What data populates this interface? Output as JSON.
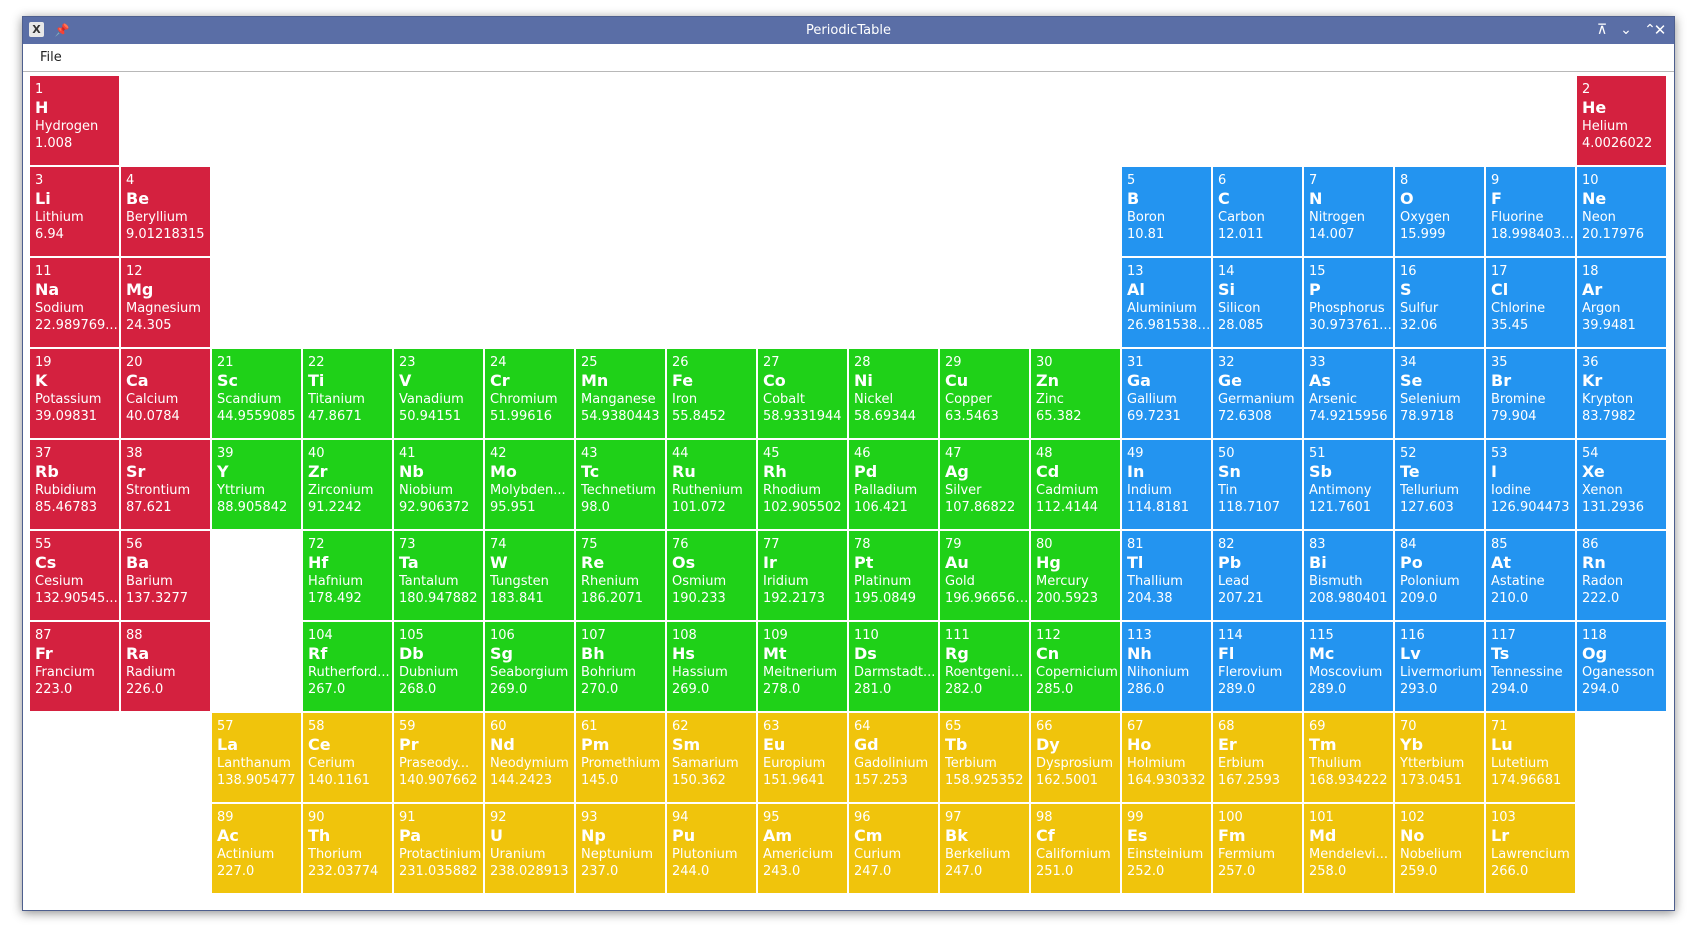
{
  "window": {
    "title": "PeriodicTable",
    "icons": {
      "app": "x-app-icon",
      "pin": "pin-icon",
      "minimize": "minimize-icon",
      "shade": "shade-icon",
      "maximize": "maximize-icon",
      "close": "close-icon"
    }
  },
  "menu": {
    "file_label": "File"
  },
  "colors": {
    "red": "#d4213f",
    "blue": "#2394f0",
    "green": "#1fd118",
    "yellow": "#f0c40c",
    "titlebar": "#5a6ea6"
  },
  "elements": [
    {
      "n": "1",
      "s": "H",
      "name": "Hydrogen",
      "w": "1.008",
      "c": "red",
      "r": 0,
      "col": 0
    },
    {
      "n": "2",
      "s": "He",
      "name": "Helium",
      "w": "4.0026022",
      "c": "red",
      "r": 0,
      "col": 17
    },
    {
      "n": "3",
      "s": "Li",
      "name": "Lithium",
      "w": "6.94",
      "c": "red",
      "r": 1,
      "col": 0
    },
    {
      "n": "4",
      "s": "Be",
      "name": "Beryllium",
      "w": "9.01218315",
      "c": "red",
      "r": 1,
      "col": 1
    },
    {
      "n": "5",
      "s": "B",
      "name": "Boron",
      "w": "10.81",
      "c": "blue",
      "r": 1,
      "col": 12
    },
    {
      "n": "6",
      "s": "C",
      "name": "Carbon",
      "w": "12.011",
      "c": "blue",
      "r": 1,
      "col": 13
    },
    {
      "n": "7",
      "s": "N",
      "name": "Nitrogen",
      "w": "14.007",
      "c": "blue",
      "r": 1,
      "col": 14
    },
    {
      "n": "8",
      "s": "O",
      "name": "Oxygen",
      "w": "15.999",
      "c": "blue",
      "r": 1,
      "col": 15
    },
    {
      "n": "9",
      "s": "F",
      "name": "Fluorine",
      "w": "18.998403...",
      "c": "blue",
      "r": 1,
      "col": 16
    },
    {
      "n": "10",
      "s": "Ne",
      "name": "Neon",
      "w": "20.17976",
      "c": "blue",
      "r": 1,
      "col": 17
    },
    {
      "n": "11",
      "s": "Na",
      "name": "Sodium",
      "w": "22.989769...",
      "c": "red",
      "r": 2,
      "col": 0
    },
    {
      "n": "12",
      "s": "Mg",
      "name": "Magnesium",
      "w": "24.305",
      "c": "red",
      "r": 2,
      "col": 1
    },
    {
      "n": "13",
      "s": "Al",
      "name": "Aluminium",
      "w": "26.98153857",
      "c": "blue",
      "r": 2,
      "col": 12
    },
    {
      "n": "14",
      "s": "Si",
      "name": "Silicon",
      "w": "28.085",
      "c": "blue",
      "r": 2,
      "col": 13
    },
    {
      "n": "15",
      "s": "P",
      "name": "Phosphorus",
      "w": "30.973761...",
      "c": "blue",
      "r": 2,
      "col": 14
    },
    {
      "n": "16",
      "s": "S",
      "name": "Sulfur",
      "w": "32.06",
      "c": "blue",
      "r": 2,
      "col": 15
    },
    {
      "n": "17",
      "s": "Cl",
      "name": "Chlorine",
      "w": "35.45",
      "c": "blue",
      "r": 2,
      "col": 16
    },
    {
      "n": "18",
      "s": "Ar",
      "name": "Argon",
      "w": "39.9481",
      "c": "blue",
      "r": 2,
      "col": 17
    },
    {
      "n": "19",
      "s": "K",
      "name": "Potassium",
      "w": "39.09831",
      "c": "red",
      "r": 3,
      "col": 0
    },
    {
      "n": "20",
      "s": "Ca",
      "name": "Calcium",
      "w": "40.0784",
      "c": "red",
      "r": 3,
      "col": 1
    },
    {
      "n": "21",
      "s": "Sc",
      "name": "Scandium",
      "w": "44.9559085",
      "c": "green",
      "r": 3,
      "col": 2
    },
    {
      "n": "22",
      "s": "Ti",
      "name": "Titanium",
      "w": "47.8671",
      "c": "green",
      "r": 3,
      "col": 3
    },
    {
      "n": "23",
      "s": "V",
      "name": "Vanadium",
      "w": "50.94151",
      "c": "green",
      "r": 3,
      "col": 4
    },
    {
      "n": "24",
      "s": "Cr",
      "name": "Chromium",
      "w": "51.99616",
      "c": "green",
      "r": 3,
      "col": 5
    },
    {
      "n": "25",
      "s": "Mn",
      "name": "Manganese",
      "w": "54.9380443",
      "c": "green",
      "r": 3,
      "col": 6
    },
    {
      "n": "26",
      "s": "Fe",
      "name": "Iron",
      "w": "55.8452",
      "c": "green",
      "r": 3,
      "col": 7
    },
    {
      "n": "27",
      "s": "Co",
      "name": "Cobalt",
      "w": "58.9331944",
      "c": "green",
      "r": 3,
      "col": 8
    },
    {
      "n": "28",
      "s": "Ni",
      "name": "Nickel",
      "w": "58.69344",
      "c": "green",
      "r": 3,
      "col": 9
    },
    {
      "n": "29",
      "s": "Cu",
      "name": "Copper",
      "w": "63.5463",
      "c": "green",
      "r": 3,
      "col": 10
    },
    {
      "n": "30",
      "s": "Zn",
      "name": "Zinc",
      "w": "65.382",
      "c": "green",
      "r": 3,
      "col": 11
    },
    {
      "n": "31",
      "s": "Ga",
      "name": "Gallium",
      "w": "69.7231",
      "c": "blue",
      "r": 3,
      "col": 12
    },
    {
      "n": "32",
      "s": "Ge",
      "name": "Germanium",
      "w": "72.6308",
      "c": "blue",
      "r": 3,
      "col": 13
    },
    {
      "n": "33",
      "s": "As",
      "name": "Arsenic",
      "w": "74.9215956",
      "c": "blue",
      "r": 3,
      "col": 14
    },
    {
      "n": "34",
      "s": "Se",
      "name": "Selenium",
      "w": "78.9718",
      "c": "blue",
      "r": 3,
      "col": 15
    },
    {
      "n": "35",
      "s": "Br",
      "name": "Bromine",
      "w": "79.904",
      "c": "blue",
      "r": 3,
      "col": 16
    },
    {
      "n": "36",
      "s": "Kr",
      "name": "Krypton",
      "w": "83.7982",
      "c": "blue",
      "r": 3,
      "col": 17
    },
    {
      "n": "37",
      "s": "Rb",
      "name": "Rubidium",
      "w": "85.46783",
      "c": "red",
      "r": 4,
      "col": 0
    },
    {
      "n": "38",
      "s": "Sr",
      "name": "Strontium",
      "w": "87.621",
      "c": "red",
      "r": 4,
      "col": 1
    },
    {
      "n": "39",
      "s": "Y",
      "name": "Yttrium",
      "w": "88.905842",
      "c": "green",
      "r": 4,
      "col": 2
    },
    {
      "n": "40",
      "s": "Zr",
      "name": "Zirconium",
      "w": "91.2242",
      "c": "green",
      "r": 4,
      "col": 3
    },
    {
      "n": "41",
      "s": "Nb",
      "name": "Niobium",
      "w": "92.906372",
      "c": "green",
      "r": 4,
      "col": 4
    },
    {
      "n": "42",
      "s": "Mo",
      "name": "Molybden...",
      "w": "95.951",
      "c": "green",
      "r": 4,
      "col": 5
    },
    {
      "n": "43",
      "s": "Tc",
      "name": "Technetium",
      "w": "98.0",
      "c": "green",
      "r": 4,
      "col": 6
    },
    {
      "n": "44",
      "s": "Ru",
      "name": "Ruthenium",
      "w": "101.072",
      "c": "green",
      "r": 4,
      "col": 7
    },
    {
      "n": "45",
      "s": "Rh",
      "name": "Rhodium",
      "w": "102.905502",
      "c": "green",
      "r": 4,
      "col": 8
    },
    {
      "n": "46",
      "s": "Pd",
      "name": "Palladium",
      "w": "106.421",
      "c": "green",
      "r": 4,
      "col": 9
    },
    {
      "n": "47",
      "s": "Ag",
      "name": "Silver",
      "w": "107.86822",
      "c": "green",
      "r": 4,
      "col": 10
    },
    {
      "n": "48",
      "s": "Cd",
      "name": "Cadmium",
      "w": "112.4144",
      "c": "green",
      "r": 4,
      "col": 11
    },
    {
      "n": "49",
      "s": "In",
      "name": "Indium",
      "w": "114.8181",
      "c": "blue",
      "r": 4,
      "col": 12
    },
    {
      "n": "50",
      "s": "Sn",
      "name": "Tin",
      "w": "118.7107",
      "c": "blue",
      "r": 4,
      "col": 13
    },
    {
      "n": "51",
      "s": "Sb",
      "name": "Antimony",
      "w": "121.7601",
      "c": "blue",
      "r": 4,
      "col": 14
    },
    {
      "n": "52",
      "s": "Te",
      "name": "Tellurium",
      "w": "127.603",
      "c": "blue",
      "r": 4,
      "col": 15
    },
    {
      "n": "53",
      "s": "I",
      "name": "Iodine",
      "w": "126.904473",
      "c": "blue",
      "r": 4,
      "col": 16
    },
    {
      "n": "54",
      "s": "Xe",
      "name": "Xenon",
      "w": "131.2936",
      "c": "blue",
      "r": 4,
      "col": 17
    },
    {
      "n": "55",
      "s": "Cs",
      "name": "Cesium",
      "w": "132.90545...",
      "c": "red",
      "r": 5,
      "col": 0
    },
    {
      "n": "56",
      "s": "Ba",
      "name": "Barium",
      "w": "137.3277",
      "c": "red",
      "r": 5,
      "col": 1
    },
    {
      "n": "72",
      "s": "Hf",
      "name": "Hafnium",
      "w": "178.492",
      "c": "green",
      "r": 5,
      "col": 3
    },
    {
      "n": "73",
      "s": "Ta",
      "name": "Tantalum",
      "w": "180.947882",
      "c": "green",
      "r": 5,
      "col": 4
    },
    {
      "n": "74",
      "s": "W",
      "name": "Tungsten",
      "w": "183.841",
      "c": "green",
      "r": 5,
      "col": 5
    },
    {
      "n": "75",
      "s": "Re",
      "name": "Rhenium",
      "w": "186.2071",
      "c": "green",
      "r": 5,
      "col": 6
    },
    {
      "n": "76",
      "s": "Os",
      "name": "Osmium",
      "w": "190.233",
      "c": "green",
      "r": 5,
      "col": 7
    },
    {
      "n": "77",
      "s": "Ir",
      "name": "Iridium",
      "w": "192.2173",
      "c": "green",
      "r": 5,
      "col": 8
    },
    {
      "n": "78",
      "s": "Pt",
      "name": "Platinum",
      "w": "195.0849",
      "c": "green",
      "r": 5,
      "col": 9
    },
    {
      "n": "79",
      "s": "Au",
      "name": "Gold",
      "w": "196.9665695",
      "c": "green",
      "r": 5,
      "col": 10
    },
    {
      "n": "80",
      "s": "Hg",
      "name": "Mercury",
      "w": "200.5923",
      "c": "green",
      "r": 5,
      "col": 11
    },
    {
      "n": "81",
      "s": "Tl",
      "name": "Thallium",
      "w": "204.38",
      "c": "blue",
      "r": 5,
      "col": 12
    },
    {
      "n": "82",
      "s": "Pb",
      "name": "Lead",
      "w": "207.21",
      "c": "blue",
      "r": 5,
      "col": 13
    },
    {
      "n": "83",
      "s": "Bi",
      "name": "Bismuth",
      "w": "208.980401",
      "c": "blue",
      "r": 5,
      "col": 14
    },
    {
      "n": "84",
      "s": "Po",
      "name": "Polonium",
      "w": "209.0",
      "c": "blue",
      "r": 5,
      "col": 15
    },
    {
      "n": "85",
      "s": "At",
      "name": "Astatine",
      "w": "210.0",
      "c": "blue",
      "r": 5,
      "col": 16
    },
    {
      "n": "86",
      "s": "Rn",
      "name": "Radon",
      "w": "222.0",
      "c": "blue",
      "r": 5,
      "col": 17
    },
    {
      "n": "87",
      "s": "Fr",
      "name": "Francium",
      "w": "223.0",
      "c": "red",
      "r": 6,
      "col": 0
    },
    {
      "n": "88",
      "s": "Ra",
      "name": "Radium",
      "w": "226.0",
      "c": "red",
      "r": 6,
      "col": 1
    },
    {
      "n": "104",
      "s": "Rf",
      "name": "Rutherford...",
      "w": "267.0",
      "c": "green",
      "r": 6,
      "col": 3
    },
    {
      "n": "105",
      "s": "Db",
      "name": "Dubnium",
      "w": "268.0",
      "c": "green",
      "r": 6,
      "col": 4
    },
    {
      "n": "106",
      "s": "Sg",
      "name": "Seaborgium",
      "w": "269.0",
      "c": "green",
      "r": 6,
      "col": 5
    },
    {
      "n": "107",
      "s": "Bh",
      "name": "Bohrium",
      "w": "270.0",
      "c": "green",
      "r": 6,
      "col": 6
    },
    {
      "n": "108",
      "s": "Hs",
      "name": "Hassium",
      "w": "269.0",
      "c": "green",
      "r": 6,
      "col": 7
    },
    {
      "n": "109",
      "s": "Mt",
      "name": "Meitnerium",
      "w": "278.0",
      "c": "green",
      "r": 6,
      "col": 8
    },
    {
      "n": "110",
      "s": "Ds",
      "name": "Darmstadt...",
      "w": "281.0",
      "c": "green",
      "r": 6,
      "col": 9
    },
    {
      "n": "111",
      "s": "Rg",
      "name": "Roentgeni...",
      "w": "282.0",
      "c": "green",
      "r": 6,
      "col": 10
    },
    {
      "n": "112",
      "s": "Cn",
      "name": "Copernicium",
      "w": "285.0",
      "c": "green",
      "r": 6,
      "col": 11
    },
    {
      "n": "113",
      "s": "Nh",
      "name": "Nihonium",
      "w": "286.0",
      "c": "blue",
      "r": 6,
      "col": 12
    },
    {
      "n": "114",
      "s": "Fl",
      "name": "Flerovium",
      "w": "289.0",
      "c": "blue",
      "r": 6,
      "col": 13
    },
    {
      "n": "115",
      "s": "Mc",
      "name": "Moscovium",
      "w": "289.0",
      "c": "blue",
      "r": 6,
      "col": 14
    },
    {
      "n": "116",
      "s": "Lv",
      "name": "Livermorium",
      "w": "293.0",
      "c": "blue",
      "r": 6,
      "col": 15
    },
    {
      "n": "117",
      "s": "Ts",
      "name": "Tennessine",
      "w": "294.0",
      "c": "blue",
      "r": 6,
      "col": 16
    },
    {
      "n": "118",
      "s": "Og",
      "name": "Oganesson",
      "w": "294.0",
      "c": "blue",
      "r": 6,
      "col": 17
    },
    {
      "n": "57",
      "s": "La",
      "name": "Lanthanum",
      "w": "138.905477",
      "c": "yellow",
      "r": 7,
      "col": 2
    },
    {
      "n": "58",
      "s": "Ce",
      "name": "Cerium",
      "w": "140.1161",
      "c": "yellow",
      "r": 7,
      "col": 3
    },
    {
      "n": "59",
      "s": "Pr",
      "name": "Praseody...",
      "w": "140.907662",
      "c": "yellow",
      "r": 7,
      "col": 4
    },
    {
      "n": "60",
      "s": "Nd",
      "name": "Neodymium",
      "w": "144.2423",
      "c": "yellow",
      "r": 7,
      "col": 5
    },
    {
      "n": "61",
      "s": "Pm",
      "name": "Promethium",
      "w": "145.0",
      "c": "yellow",
      "r": 7,
      "col": 6
    },
    {
      "n": "62",
      "s": "Sm",
      "name": "Samarium",
      "w": "150.362",
      "c": "yellow",
      "r": 7,
      "col": 7
    },
    {
      "n": "63",
      "s": "Eu",
      "name": "Europium",
      "w": "151.9641",
      "c": "yellow",
      "r": 7,
      "col": 8
    },
    {
      "n": "64",
      "s": "Gd",
      "name": "Gadolinium",
      "w": "157.253",
      "c": "yellow",
      "r": 7,
      "col": 9
    },
    {
      "n": "65",
      "s": "Tb",
      "name": "Terbium",
      "w": "158.925352",
      "c": "yellow",
      "r": 7,
      "col": 10
    },
    {
      "n": "66",
      "s": "Dy",
      "name": "Dysprosium",
      "w": "162.5001",
      "c": "yellow",
      "r": 7,
      "col": 11
    },
    {
      "n": "67",
      "s": "Ho",
      "name": "Holmium",
      "w": "164.930332",
      "c": "yellow",
      "r": 7,
      "col": 12
    },
    {
      "n": "68",
      "s": "Er",
      "name": "Erbium",
      "w": "167.2593",
      "c": "yellow",
      "r": 7,
      "col": 13
    },
    {
      "n": "69",
      "s": "Tm",
      "name": "Thulium",
      "w": "168.934222",
      "c": "yellow",
      "r": 7,
      "col": 14
    },
    {
      "n": "70",
      "s": "Yb",
      "name": "Ytterbium",
      "w": "173.0451",
      "c": "yellow",
      "r": 7,
      "col": 15
    },
    {
      "n": "71",
      "s": "Lu",
      "name": "Lutetium",
      "w": "174.96681",
      "c": "yellow",
      "r": 7,
      "col": 16
    },
    {
      "n": "89",
      "s": "Ac",
      "name": "Actinium",
      "w": "227.0",
      "c": "yellow",
      "r": 8,
      "col": 2
    },
    {
      "n": "90",
      "s": "Th",
      "name": "Thorium",
      "w": "232.03774",
      "c": "yellow",
      "r": 8,
      "col": 3
    },
    {
      "n": "91",
      "s": "Pa",
      "name": "Protactinium",
      "w": "231.035882",
      "c": "yellow",
      "r": 8,
      "col": 4
    },
    {
      "n": "92",
      "s": "U",
      "name": "Uranium",
      "w": "238.028913",
      "c": "yellow",
      "r": 8,
      "col": 5
    },
    {
      "n": "93",
      "s": "Np",
      "name": "Neptunium",
      "w": "237.0",
      "c": "yellow",
      "r": 8,
      "col": 6
    },
    {
      "n": "94",
      "s": "Pu",
      "name": "Plutonium",
      "w": "244.0",
      "c": "yellow",
      "r": 8,
      "col": 7
    },
    {
      "n": "95",
      "s": "Am",
      "name": "Americium",
      "w": "243.0",
      "c": "yellow",
      "r": 8,
      "col": 8
    },
    {
      "n": "96",
      "s": "Cm",
      "name": "Curium",
      "w": "247.0",
      "c": "yellow",
      "r": 8,
      "col": 9
    },
    {
      "n": "97",
      "s": "Bk",
      "name": "Berkelium",
      "w": "247.0",
      "c": "yellow",
      "r": 8,
      "col": 10
    },
    {
      "n": "98",
      "s": "Cf",
      "name": "Californium",
      "w": "251.0",
      "c": "yellow",
      "r": 8,
      "col": 11
    },
    {
      "n": "99",
      "s": "Es",
      "name": "Einsteinium",
      "w": "252.0",
      "c": "yellow",
      "r": 8,
      "col": 12
    },
    {
      "n": "100",
      "s": "Fm",
      "name": "Fermium",
      "w": "257.0",
      "c": "yellow",
      "r": 8,
      "col": 13
    },
    {
      "n": "101",
      "s": "Md",
      "name": "Mendelevi...",
      "w": "258.0",
      "c": "yellow",
      "r": 8,
      "col": 14
    },
    {
      "n": "102",
      "s": "No",
      "name": "Nobelium",
      "w": "259.0",
      "c": "yellow",
      "r": 8,
      "col": 15
    },
    {
      "n": "103",
      "s": "Lr",
      "name": "Lawrencium",
      "w": "266.0",
      "c": "yellow",
      "r": 8,
      "col": 16
    }
  ]
}
